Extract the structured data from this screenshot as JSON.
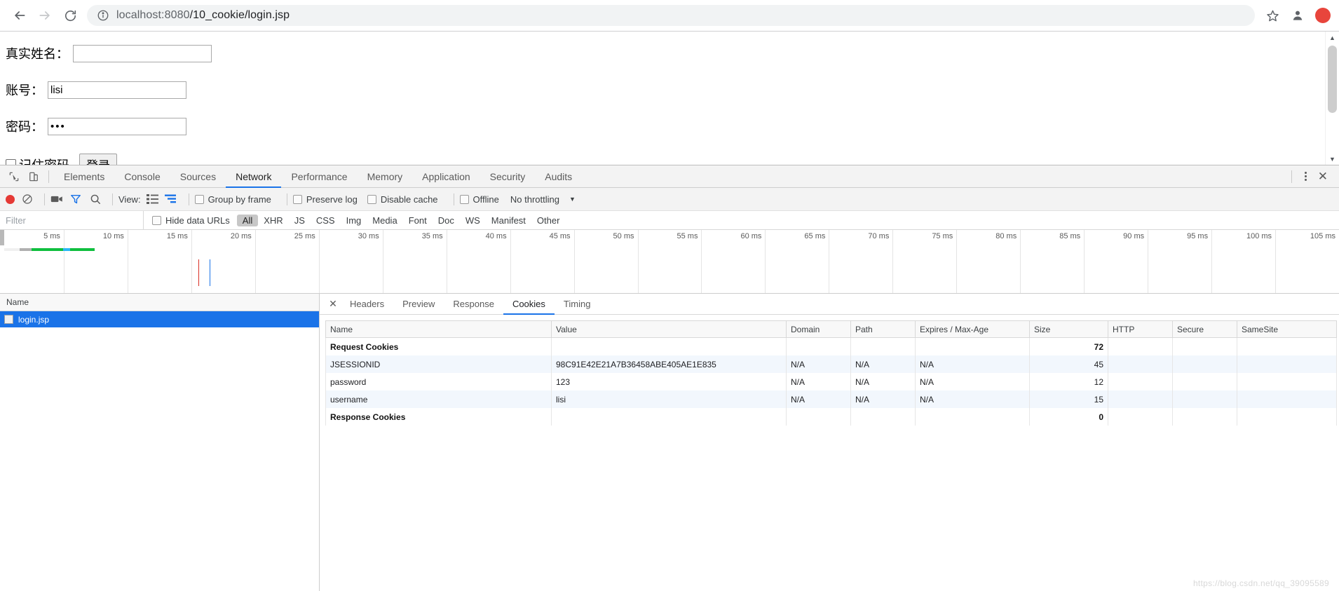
{
  "browser": {
    "back_icon": "arrow-left-icon",
    "forward_icon": "arrow-right-icon",
    "reload_icon": "reload-icon",
    "info_icon": "info-circle-icon",
    "url_host": "localhost:8080",
    "url_path": "/10_cookie/login.jsp",
    "bookmark_icon": "star-icon",
    "profile_icon": "avatar-icon",
    "extension_icon": "extension-badge-icon"
  },
  "page": {
    "fields": [
      {
        "label": "真实姓名：",
        "value": "",
        "name": "realname"
      },
      {
        "label": "账号：",
        "value": "lisi",
        "name": "username"
      },
      {
        "label": "密码：",
        "value": "•••",
        "name": "password"
      }
    ],
    "remember_label": "记住密码",
    "submit_label": "登录"
  },
  "devtools": {
    "inspect_icon": "cursor-inspect-icon",
    "device_icon": "device-toggle-icon",
    "tabs": [
      "Elements",
      "Console",
      "Sources",
      "Network",
      "Performance",
      "Memory",
      "Application",
      "Security",
      "Audits"
    ],
    "active_tab": "Network",
    "more_icon": "kebab-menu-icon",
    "close_icon": "close-icon"
  },
  "network_toolbar": {
    "record_icon": "record-dot-icon",
    "clear_icon": "clear-no-entry-icon",
    "camera_icon": "camera-filmstrip-icon",
    "filter_icon": "funnel-icon",
    "search_icon": "search-icon",
    "view_label": "View:",
    "view_list_icon": "list-view-icon",
    "view_waterfall_icon": "waterfall-view-icon",
    "group_by_frame": "Group by frame",
    "preserve_log": "Preserve log",
    "disable_cache": "Disable cache",
    "offline": "Offline",
    "throttling": "No throttling",
    "caret_icon": "chevron-down-icon"
  },
  "filter_bar": {
    "placeholder": "Filter",
    "value": "",
    "hide_data_urls": "Hide data URLs",
    "types": [
      "All",
      "XHR",
      "JS",
      "CSS",
      "Img",
      "Media",
      "Font",
      "Doc",
      "WS",
      "Manifest",
      "Other"
    ],
    "active_type": "All"
  },
  "overview": {
    "ticks": [
      "5 ms",
      "10 ms",
      "15 ms",
      "20 ms",
      "25 ms",
      "30 ms",
      "35 ms",
      "40 ms",
      "45 ms",
      "50 ms",
      "55 ms",
      "60 ms",
      "65 ms",
      "70 ms",
      "75 ms",
      "80 ms",
      "85 ms",
      "90 ms",
      "95 ms",
      "100 ms",
      "105 ms"
    ],
    "dom_content_loaded_color": "#d93025",
    "load_color": "#1a73e8",
    "bar_colors": {
      "stalled": "#f0f0f0",
      "wait": "#b0b0b0",
      "download": "#0fbf3e",
      "tail": "#29b6f6"
    }
  },
  "requests": {
    "column_header": "Name",
    "rows": [
      {
        "name": "login.jsp",
        "selected": true
      }
    ]
  },
  "detail": {
    "close_icon": "close-icon",
    "tabs": [
      "Headers",
      "Preview",
      "Response",
      "Cookies",
      "Timing"
    ],
    "active_tab": "Cookies"
  },
  "cookies_table": {
    "columns": [
      "Name",
      "Value",
      "Domain",
      "Path",
      "Expires / Max-Age",
      "Size",
      "HTTP",
      "Secure",
      "SameSite"
    ],
    "rows": [
      {
        "type": "section",
        "name": "Request Cookies",
        "value": "",
        "domain": "",
        "path": "",
        "expires": "",
        "size": "72",
        "http": "",
        "secure": "",
        "samesite": ""
      },
      {
        "type": "cookie",
        "name": "JSESSIONID",
        "value": "98C91E42E21A7B36458ABE405AE1E835",
        "domain": "N/A",
        "path": "N/A",
        "expires": "N/A",
        "size": "45",
        "http": "",
        "secure": "",
        "samesite": ""
      },
      {
        "type": "cookie",
        "name": "password",
        "value": "123",
        "domain": "N/A",
        "path": "N/A",
        "expires": "N/A",
        "size": "12",
        "http": "",
        "secure": "",
        "samesite": ""
      },
      {
        "type": "cookie",
        "name": "username",
        "value": "lisi",
        "domain": "N/A",
        "path": "N/A",
        "expires": "N/A",
        "size": "15",
        "http": "",
        "secure": "",
        "samesite": ""
      },
      {
        "type": "section",
        "name": "Response Cookies",
        "value": "",
        "domain": "",
        "path": "",
        "expires": "",
        "size": "0",
        "http": "",
        "secure": "",
        "samesite": ""
      }
    ]
  },
  "watermark": "https://blog.csdn.net/qq_39095589"
}
